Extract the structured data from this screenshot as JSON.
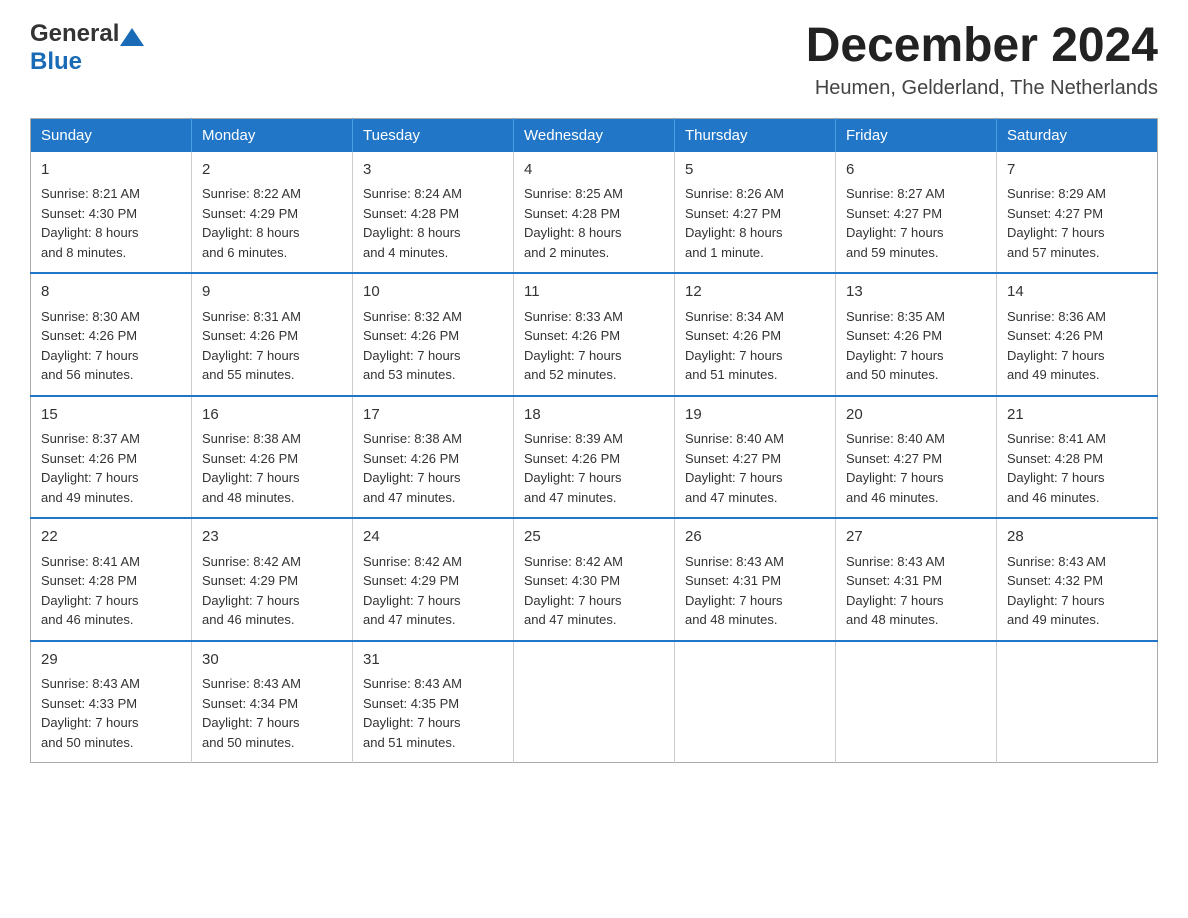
{
  "header": {
    "logo_line1": "General",
    "logo_line2": "Blue",
    "month_title": "December 2024",
    "location": "Heumen, Gelderland, The Netherlands"
  },
  "weekdays": [
    "Sunday",
    "Monday",
    "Tuesday",
    "Wednesday",
    "Thursday",
    "Friday",
    "Saturday"
  ],
  "weeks": [
    [
      {
        "day": "1",
        "sunrise": "Sunrise: 8:21 AM",
        "sunset": "Sunset: 4:30 PM",
        "daylight": "Daylight: 8 hours",
        "daylight2": "and 8 minutes."
      },
      {
        "day": "2",
        "sunrise": "Sunrise: 8:22 AM",
        "sunset": "Sunset: 4:29 PM",
        "daylight": "Daylight: 8 hours",
        "daylight2": "and 6 minutes."
      },
      {
        "day": "3",
        "sunrise": "Sunrise: 8:24 AM",
        "sunset": "Sunset: 4:28 PM",
        "daylight": "Daylight: 8 hours",
        "daylight2": "and 4 minutes."
      },
      {
        "day": "4",
        "sunrise": "Sunrise: 8:25 AM",
        "sunset": "Sunset: 4:28 PM",
        "daylight": "Daylight: 8 hours",
        "daylight2": "and 2 minutes."
      },
      {
        "day": "5",
        "sunrise": "Sunrise: 8:26 AM",
        "sunset": "Sunset: 4:27 PM",
        "daylight": "Daylight: 8 hours",
        "daylight2": "and 1 minute."
      },
      {
        "day": "6",
        "sunrise": "Sunrise: 8:27 AM",
        "sunset": "Sunset: 4:27 PM",
        "daylight": "Daylight: 7 hours",
        "daylight2": "and 59 minutes."
      },
      {
        "day": "7",
        "sunrise": "Sunrise: 8:29 AM",
        "sunset": "Sunset: 4:27 PM",
        "daylight": "Daylight: 7 hours",
        "daylight2": "and 57 minutes."
      }
    ],
    [
      {
        "day": "8",
        "sunrise": "Sunrise: 8:30 AM",
        "sunset": "Sunset: 4:26 PM",
        "daylight": "Daylight: 7 hours",
        "daylight2": "and 56 minutes."
      },
      {
        "day": "9",
        "sunrise": "Sunrise: 8:31 AM",
        "sunset": "Sunset: 4:26 PM",
        "daylight": "Daylight: 7 hours",
        "daylight2": "and 55 minutes."
      },
      {
        "day": "10",
        "sunrise": "Sunrise: 8:32 AM",
        "sunset": "Sunset: 4:26 PM",
        "daylight": "Daylight: 7 hours",
        "daylight2": "and 53 minutes."
      },
      {
        "day": "11",
        "sunrise": "Sunrise: 8:33 AM",
        "sunset": "Sunset: 4:26 PM",
        "daylight": "Daylight: 7 hours",
        "daylight2": "and 52 minutes."
      },
      {
        "day": "12",
        "sunrise": "Sunrise: 8:34 AM",
        "sunset": "Sunset: 4:26 PM",
        "daylight": "Daylight: 7 hours",
        "daylight2": "and 51 minutes."
      },
      {
        "day": "13",
        "sunrise": "Sunrise: 8:35 AM",
        "sunset": "Sunset: 4:26 PM",
        "daylight": "Daylight: 7 hours",
        "daylight2": "and 50 minutes."
      },
      {
        "day": "14",
        "sunrise": "Sunrise: 8:36 AM",
        "sunset": "Sunset: 4:26 PM",
        "daylight": "Daylight: 7 hours",
        "daylight2": "and 49 minutes."
      }
    ],
    [
      {
        "day": "15",
        "sunrise": "Sunrise: 8:37 AM",
        "sunset": "Sunset: 4:26 PM",
        "daylight": "Daylight: 7 hours",
        "daylight2": "and 49 minutes."
      },
      {
        "day": "16",
        "sunrise": "Sunrise: 8:38 AM",
        "sunset": "Sunset: 4:26 PM",
        "daylight": "Daylight: 7 hours",
        "daylight2": "and 48 minutes."
      },
      {
        "day": "17",
        "sunrise": "Sunrise: 8:38 AM",
        "sunset": "Sunset: 4:26 PM",
        "daylight": "Daylight: 7 hours",
        "daylight2": "and 47 minutes."
      },
      {
        "day": "18",
        "sunrise": "Sunrise: 8:39 AM",
        "sunset": "Sunset: 4:26 PM",
        "daylight": "Daylight: 7 hours",
        "daylight2": "and 47 minutes."
      },
      {
        "day": "19",
        "sunrise": "Sunrise: 8:40 AM",
        "sunset": "Sunset: 4:27 PM",
        "daylight": "Daylight: 7 hours",
        "daylight2": "and 47 minutes."
      },
      {
        "day": "20",
        "sunrise": "Sunrise: 8:40 AM",
        "sunset": "Sunset: 4:27 PM",
        "daylight": "Daylight: 7 hours",
        "daylight2": "and 46 minutes."
      },
      {
        "day": "21",
        "sunrise": "Sunrise: 8:41 AM",
        "sunset": "Sunset: 4:28 PM",
        "daylight": "Daylight: 7 hours",
        "daylight2": "and 46 minutes."
      }
    ],
    [
      {
        "day": "22",
        "sunrise": "Sunrise: 8:41 AM",
        "sunset": "Sunset: 4:28 PM",
        "daylight": "Daylight: 7 hours",
        "daylight2": "and 46 minutes."
      },
      {
        "day": "23",
        "sunrise": "Sunrise: 8:42 AM",
        "sunset": "Sunset: 4:29 PM",
        "daylight": "Daylight: 7 hours",
        "daylight2": "and 46 minutes."
      },
      {
        "day": "24",
        "sunrise": "Sunrise: 8:42 AM",
        "sunset": "Sunset: 4:29 PM",
        "daylight": "Daylight: 7 hours",
        "daylight2": "and 47 minutes."
      },
      {
        "day": "25",
        "sunrise": "Sunrise: 8:42 AM",
        "sunset": "Sunset: 4:30 PM",
        "daylight": "Daylight: 7 hours",
        "daylight2": "and 47 minutes."
      },
      {
        "day": "26",
        "sunrise": "Sunrise: 8:43 AM",
        "sunset": "Sunset: 4:31 PM",
        "daylight": "Daylight: 7 hours",
        "daylight2": "and 48 minutes."
      },
      {
        "day": "27",
        "sunrise": "Sunrise: 8:43 AM",
        "sunset": "Sunset: 4:31 PM",
        "daylight": "Daylight: 7 hours",
        "daylight2": "and 48 minutes."
      },
      {
        "day": "28",
        "sunrise": "Sunrise: 8:43 AM",
        "sunset": "Sunset: 4:32 PM",
        "daylight": "Daylight: 7 hours",
        "daylight2": "and 49 minutes."
      }
    ],
    [
      {
        "day": "29",
        "sunrise": "Sunrise: 8:43 AM",
        "sunset": "Sunset: 4:33 PM",
        "daylight": "Daylight: 7 hours",
        "daylight2": "and 50 minutes."
      },
      {
        "day": "30",
        "sunrise": "Sunrise: 8:43 AM",
        "sunset": "Sunset: 4:34 PM",
        "daylight": "Daylight: 7 hours",
        "daylight2": "and 50 minutes."
      },
      {
        "day": "31",
        "sunrise": "Sunrise: 8:43 AM",
        "sunset": "Sunset: 4:35 PM",
        "daylight": "Daylight: 7 hours",
        "daylight2": "and 51 minutes."
      },
      null,
      null,
      null,
      null
    ]
  ]
}
